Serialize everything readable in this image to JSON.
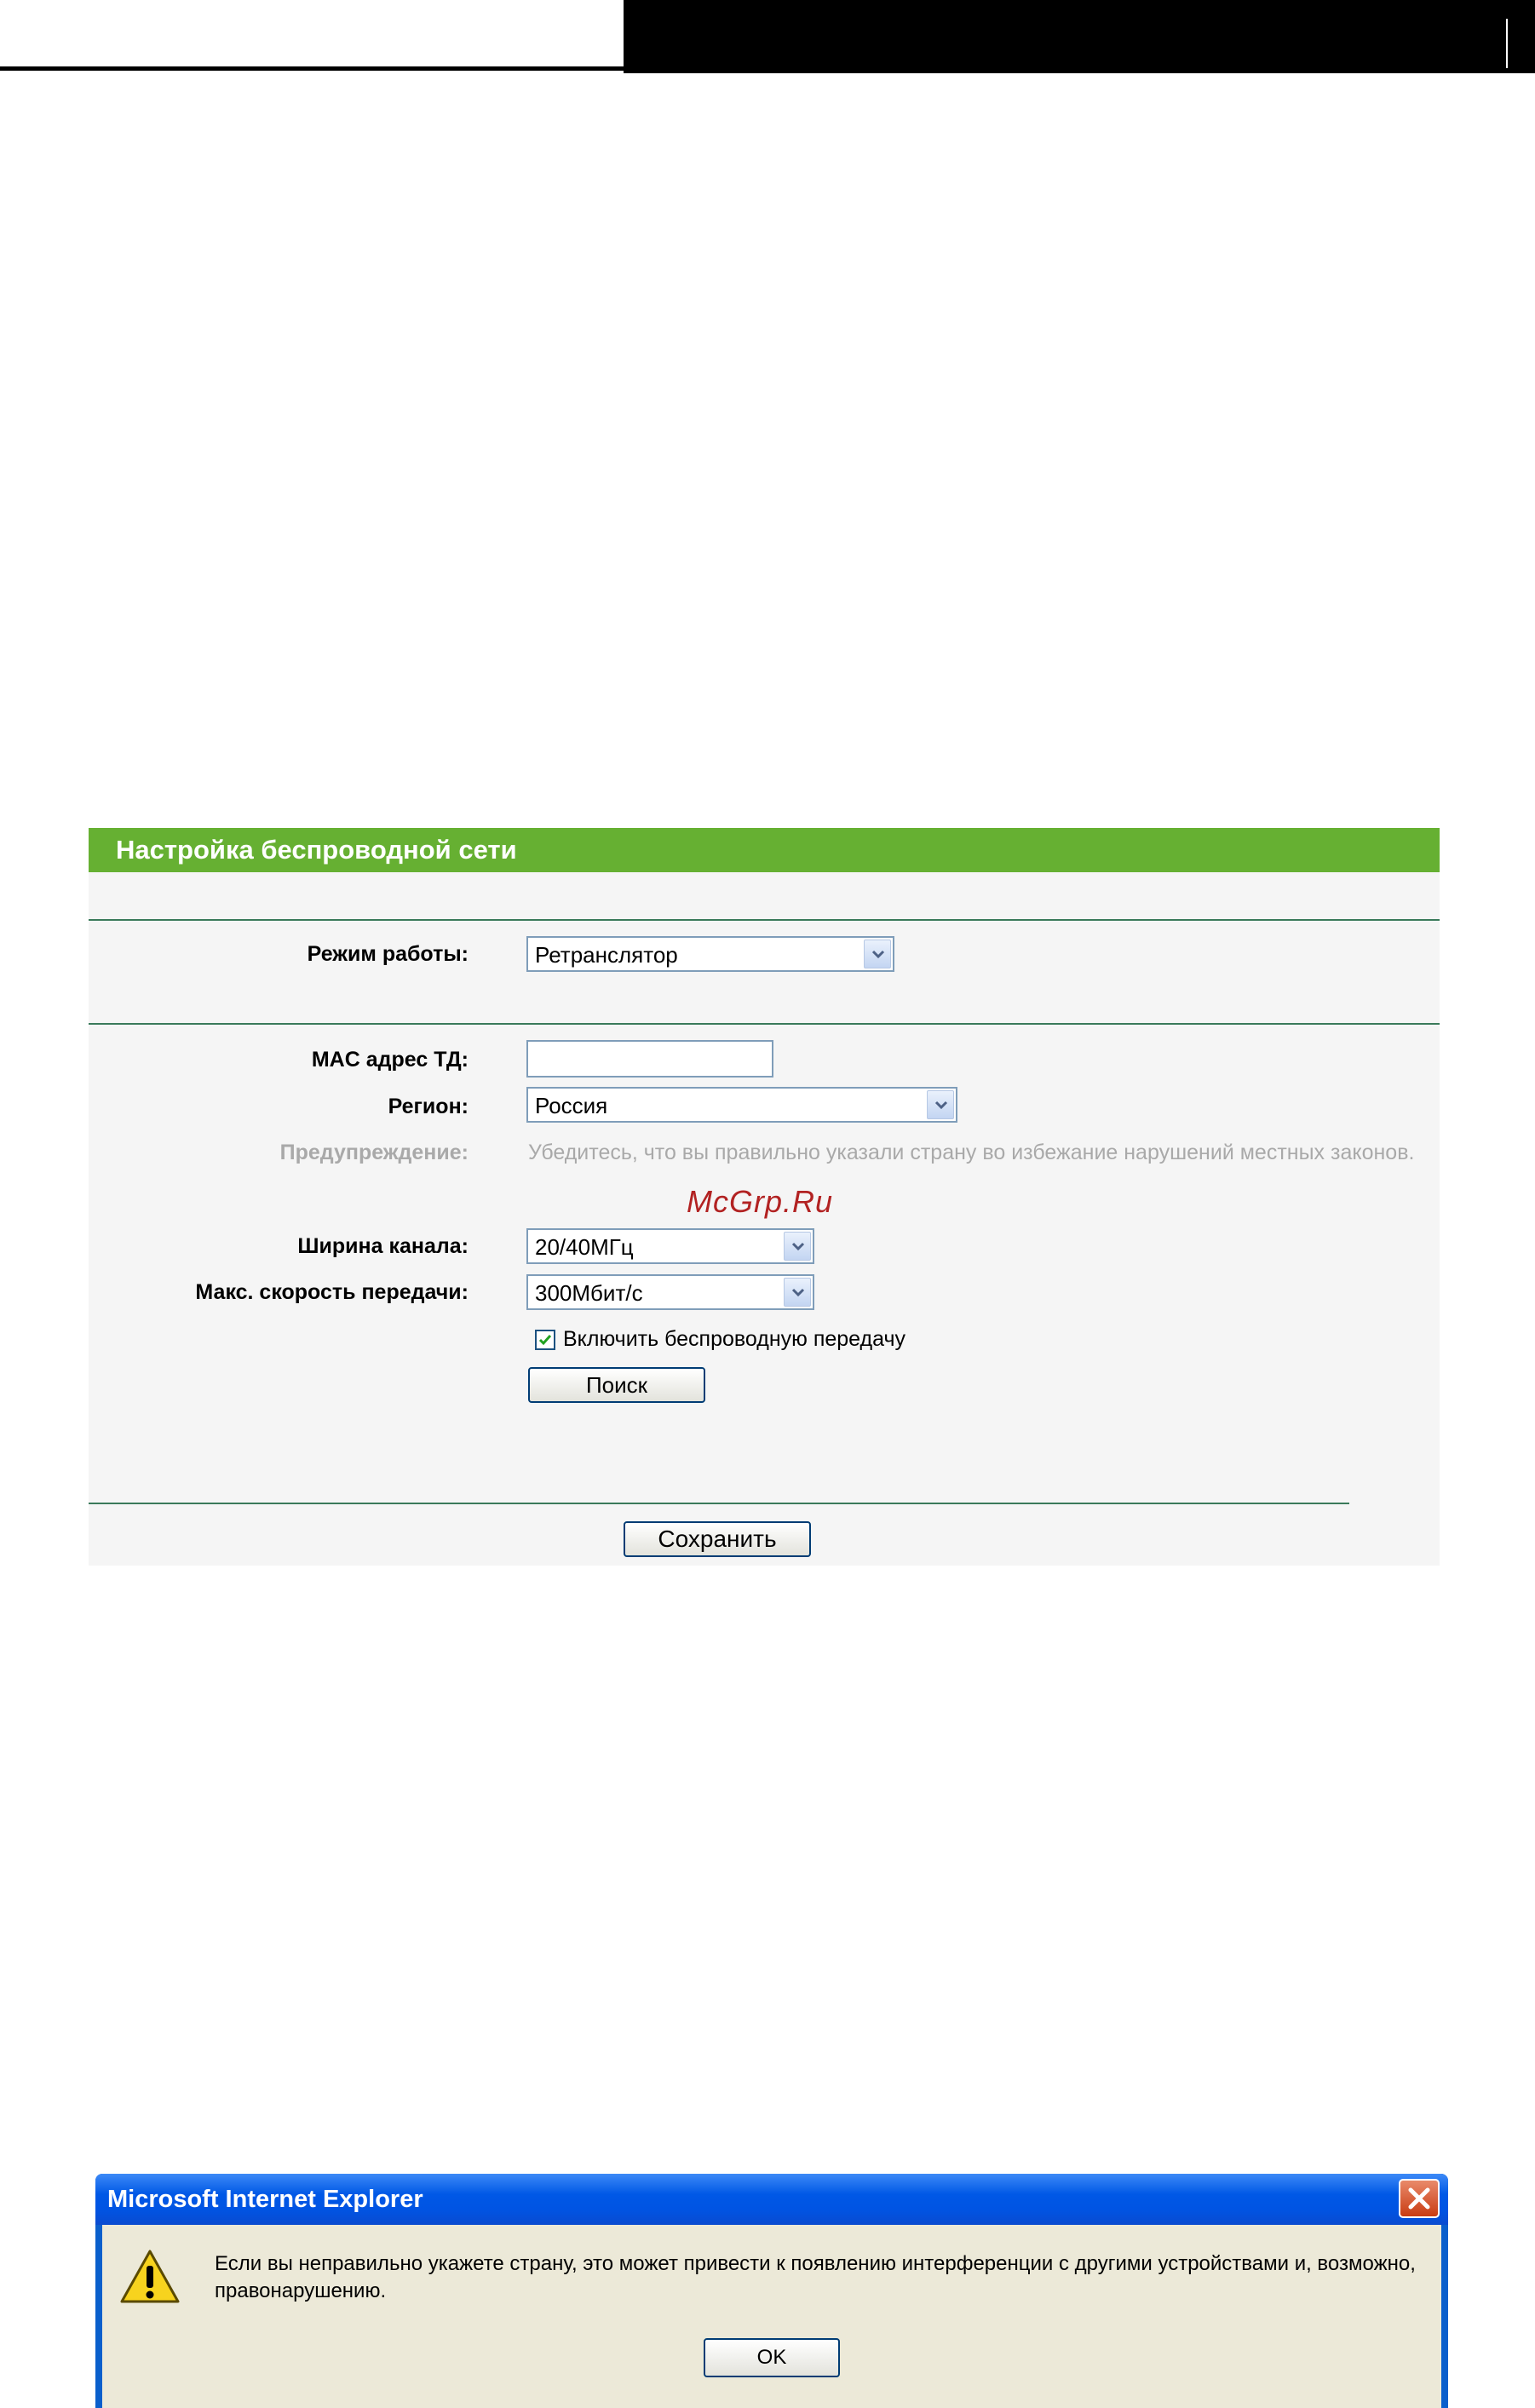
{
  "panel": {
    "title": "Настройка беспроводной сети",
    "mode_label": "Режим работы:",
    "mode_value": "Ретранслятор",
    "mac_label": "MAC адрес ТД:",
    "mac_value": "",
    "region_label": "Регион:",
    "region_value": "Россия",
    "warning_label": "Предупреждение:",
    "warning_text": "Убедитесь, что вы правильно указали страну во избежание нарушений местных законов.",
    "watermark": "McGrp.Ru",
    "channel_width_label": "Ширина канала:",
    "channel_width_value": "20/40МГц",
    "max_rate_label": "Макс. скорость передачи:",
    "max_rate_value": "300Мбит/с",
    "enable_wireless_label": "Включить беспроводную передачу",
    "enable_wireless_checked": true,
    "search_button": "Поиск",
    "save_button": "Сохранить"
  },
  "dialog": {
    "title": "Microsoft Internet Explorer",
    "message": "Если вы неправильно укажете страну, это может привести к появлению интерференции с другими устройствами и, возможно, правонарушению.",
    "ok_button": "OK"
  },
  "colors": {
    "panel_header": "#66b032",
    "divider": "#3a7a5a",
    "dialog_title": "#0054e3",
    "dialog_body": "#ece9d8"
  }
}
